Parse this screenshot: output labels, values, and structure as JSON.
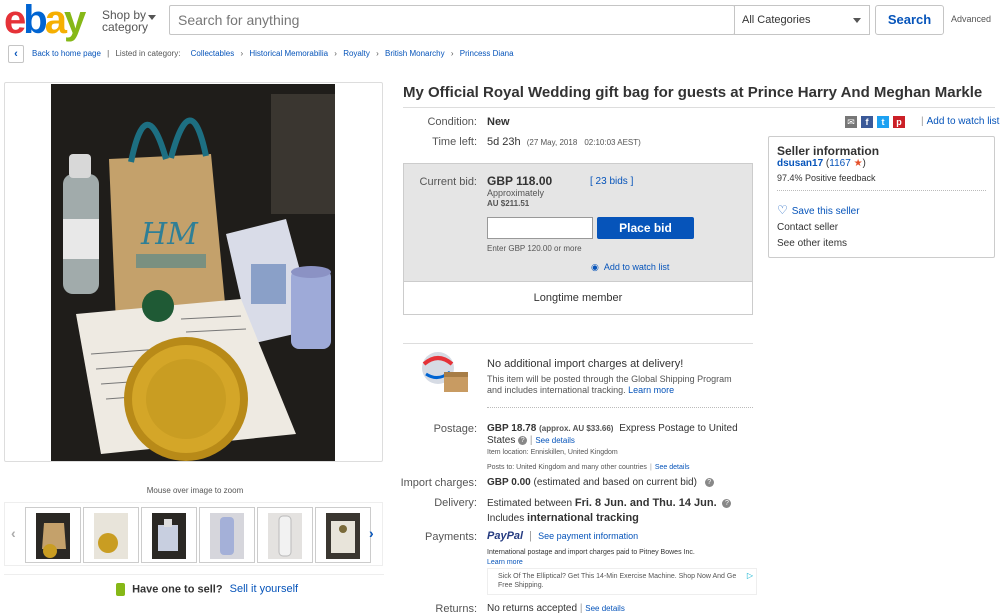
{
  "header": {
    "logo_letters": [
      "e",
      "b",
      "a",
      "y"
    ],
    "logo_colors": [
      "#e53238",
      "#0064d2",
      "#f5af02",
      "#86b817"
    ],
    "shop_by_line1": "Shop by",
    "shop_by_line2": "category",
    "search_placeholder": "Search for anything",
    "category_value": "All Categories",
    "search_button": "Search",
    "advanced": "Advanced"
  },
  "breadcrumb": {
    "back": "Back to home page",
    "listed_in": "Listed in category:",
    "items": [
      "Collectables",
      "Historical Memorabilia",
      "Royalty",
      "British Monarchy",
      "Princess Diana"
    ]
  },
  "gallery": {
    "zoom_hint": "Mouse over image to zoom",
    "sell": "Have one to sell?",
    "sell_link": "Sell it yourself"
  },
  "listing": {
    "title": "My Official Royal Wedding gift bag for guests at Prince Harry And Meghan Markle",
    "condition_label": "Condition:",
    "condition": "New",
    "time_left_label": "Time left:",
    "time_left": "5d 23h",
    "time_left_detail": "(27 May, 2018",
    "time_left_time": "02:10:03 AEST)",
    "current_bid_label": "Current bid:",
    "current_bid": "GBP 118.00",
    "approx_label": "Approximately",
    "approx_value": "AU $211.51",
    "bids": "[ 23 bids ]",
    "enter_bid_hint": "Enter GBP 120.00 or more",
    "place_bid": "Place bid",
    "add_watch": "Add to watch list",
    "longtime": "Longtime member",
    "import_title": "No additional import charges at delivery!",
    "import_desc_1": "This item will be posted through the Global Shipping Program",
    "import_desc_2": "and includes international tracking.",
    "learn_more": "Learn more",
    "postage_label": "Postage:",
    "postage_value": "GBP 18.78",
    "postage_approx": "(approx. AU $33.66)",
    "postage_service_1": "Express Postage to United",
    "postage_service_2": "States",
    "see_details": "See details",
    "item_location": "Item location:  Enniskillen, United Kingdom",
    "posts_to": "Posts to:  United Kingdom and many other countries",
    "import_charges_label": "Import charges:",
    "import_charges_value": "GBP 0.00",
    "import_charges_note": "(estimated and based on current bid)",
    "delivery_label": "Delivery:",
    "delivery_prefix": "Estimated between",
    "delivery_dates": "Fri. 8 Jun. and Thu. 14 Jun.",
    "delivery_includes": "Includes",
    "delivery_tracking": "international tracking",
    "payments_label": "Payments:",
    "paypal": "PayPal",
    "see_payment": "See payment information",
    "payment_note": "International postage and import charges paid to Pitney Bowes Inc.",
    "payment_learn": "Learn more",
    "ad_text_1": "Sick Of The Elliptical? Get This 14-Min Exercise Machine. Shop Now And Ge",
    "ad_text_2": "Free Shipping.",
    "returns_label": "Returns:",
    "returns_value": "No returns accepted",
    "returns_details": "See details"
  },
  "seller": {
    "heading": "Seller information",
    "name": "dsusan17",
    "feedback_open": "(",
    "feedback_count": "1167",
    "feedback_close": ")",
    "positive": "97.4% Positive feedback",
    "save": "Save this seller",
    "contact": "Contact seller",
    "other": "See other items"
  },
  "colors": {
    "link": "#0654ba",
    "bid_bg": "#e5e5e5",
    "star": "#e5502a"
  }
}
